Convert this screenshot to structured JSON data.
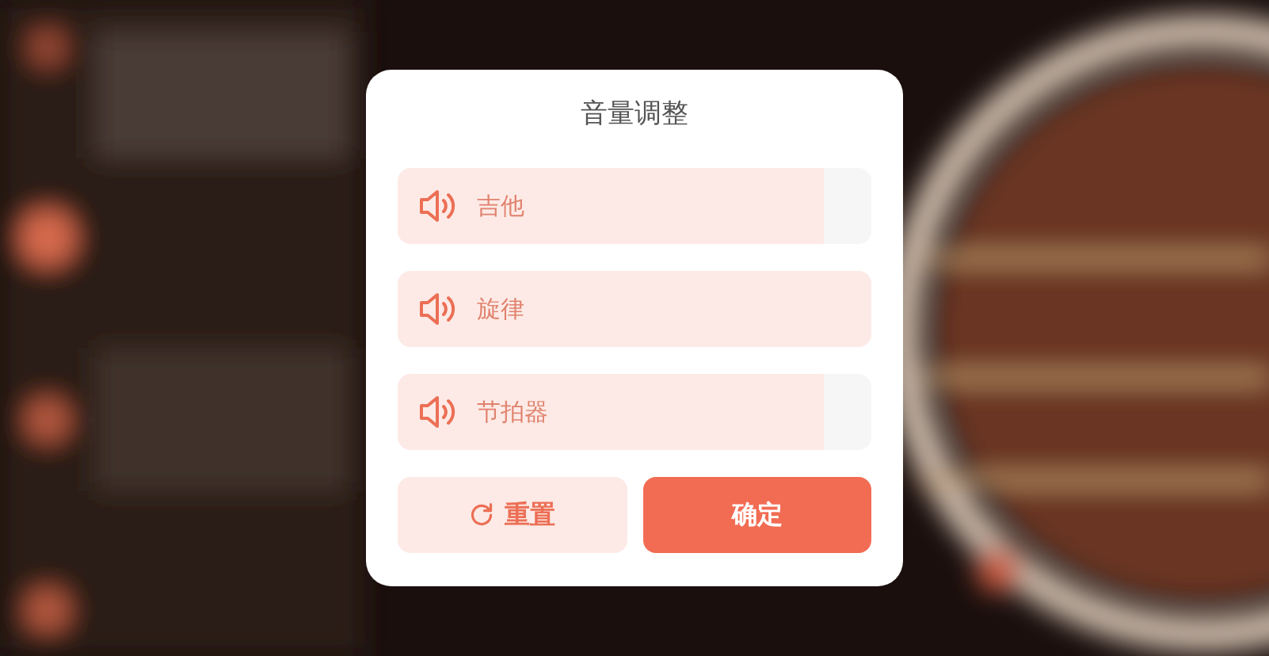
{
  "dialog": {
    "title": "音量调整",
    "channels": [
      {
        "name": "吉他",
        "level": 0.9
      },
      {
        "name": "旋律",
        "level": 1.0
      },
      {
        "name": "节拍器",
        "level": 0.9
      }
    ],
    "buttons": [
      {
        "kind": "reset",
        "label": "重置"
      },
      {
        "kind": "confirm",
        "label": "确定"
      }
    ]
  }
}
